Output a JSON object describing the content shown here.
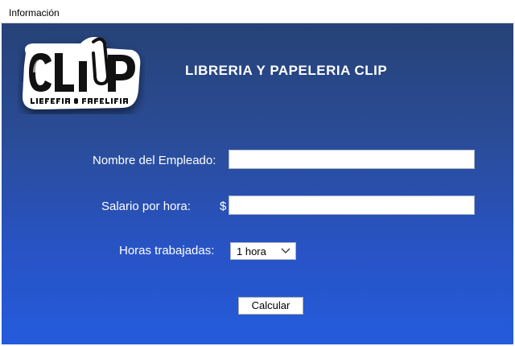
{
  "window": {
    "title": "Información"
  },
  "header": {
    "logo_text": "CLIP",
    "logo_subtext": "LIBRERIA & PAPELERIA",
    "heading": "LIBRERIA Y PAPELERIA CLIP"
  },
  "form": {
    "employee_name_label": "Nombre del Empleado:",
    "employee_name_value": "",
    "hourly_salary_label": "Salario por hora:",
    "currency_symbol": "$",
    "hourly_salary_value": "",
    "hours_worked_label": "Horas trabajadas:",
    "hours_worked_selected": "1 hora",
    "calculate_button": "Calcular"
  },
  "colors": {
    "gradient_top": "#264277",
    "gradient_bottom": "#245bdc",
    "text": "#ffffff"
  }
}
